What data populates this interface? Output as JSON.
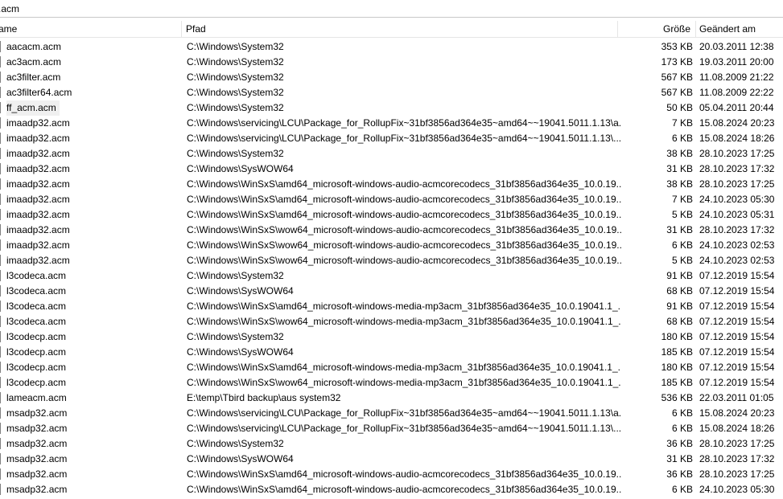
{
  "search": {
    "value": ".acm"
  },
  "columns": {
    "name": "ame",
    "path": "Pfad",
    "size": "Größe",
    "modified": "Geändert am"
  },
  "rows": [
    {
      "name": "aacacm.acm",
      "path": "C:\\Windows\\System32",
      "size": "353 KB",
      "date": "20.03.2011 12:38"
    },
    {
      "name": "ac3acm.acm",
      "path": "C:\\Windows\\System32",
      "size": "173 KB",
      "date": "19.03.2011 20:00"
    },
    {
      "name": "ac3filter.acm",
      "path": "C:\\Windows\\System32",
      "size": "567 KB",
      "date": "11.08.2009 21:22"
    },
    {
      "name": "ac3filter64.acm",
      "path": "C:\\Windows\\System32",
      "size": "567 KB",
      "date": "11.08.2009 22:22"
    },
    {
      "name": "ff_acm.acm",
      "path": "C:\\Windows\\System32",
      "size": "50 KB",
      "date": "05.04.2011 20:44"
    },
    {
      "name": "imaadp32.acm",
      "path": "C:\\Windows\\servicing\\LCU\\Package_for_RollupFix~31bf3856ad364e35~amd64~~19041.5011.1.13\\a...",
      "size": "7 KB",
      "date": "15.08.2024 20:23"
    },
    {
      "name": "imaadp32.acm",
      "path": "C:\\Windows\\servicing\\LCU\\Package_for_RollupFix~31bf3856ad364e35~amd64~~19041.5011.1.13\\...",
      "size": "6 KB",
      "date": "15.08.2024 18:26"
    },
    {
      "name": "imaadp32.acm",
      "path": "C:\\Windows\\System32",
      "size": "38 KB",
      "date": "28.10.2023 17:25"
    },
    {
      "name": "imaadp32.acm",
      "path": "C:\\Windows\\SysWOW64",
      "size": "31 KB",
      "date": "28.10.2023 17:32"
    },
    {
      "name": "imaadp32.acm",
      "path": "C:\\Windows\\WinSxS\\amd64_microsoft-windows-audio-acmcorecodecs_31bf3856ad364e35_10.0.19...",
      "size": "38 KB",
      "date": "28.10.2023 17:25"
    },
    {
      "name": "imaadp32.acm",
      "path": "C:\\Windows\\WinSxS\\amd64_microsoft-windows-audio-acmcorecodecs_31bf3856ad364e35_10.0.19...",
      "size": "7 KB",
      "date": "24.10.2023 05:30"
    },
    {
      "name": "imaadp32.acm",
      "path": "C:\\Windows\\WinSxS\\amd64_microsoft-windows-audio-acmcorecodecs_31bf3856ad364e35_10.0.19...",
      "size": "5 KB",
      "date": "24.10.2023 05:31"
    },
    {
      "name": "imaadp32.acm",
      "path": "C:\\Windows\\WinSxS\\wow64_microsoft-windows-audio-acmcorecodecs_31bf3856ad364e35_10.0.19...",
      "size": "31 KB",
      "date": "28.10.2023 17:32"
    },
    {
      "name": "imaadp32.acm",
      "path": "C:\\Windows\\WinSxS\\wow64_microsoft-windows-audio-acmcorecodecs_31bf3856ad364e35_10.0.19...",
      "size": "6 KB",
      "date": "24.10.2023 02:53"
    },
    {
      "name": "imaadp32.acm",
      "path": "C:\\Windows\\WinSxS\\wow64_microsoft-windows-audio-acmcorecodecs_31bf3856ad364e35_10.0.19...",
      "size": "5 KB",
      "date": "24.10.2023 02:53"
    },
    {
      "name": "l3codeca.acm",
      "path": "C:\\Windows\\System32",
      "size": "91 KB",
      "date": "07.12.2019 15:54"
    },
    {
      "name": "l3codeca.acm",
      "path": "C:\\Windows\\SysWOW64",
      "size": "68 KB",
      "date": "07.12.2019 15:54"
    },
    {
      "name": "l3codeca.acm",
      "path": "C:\\Windows\\WinSxS\\amd64_microsoft-windows-media-mp3acm_31bf3856ad364e35_10.0.19041.1_...",
      "size": "91 KB",
      "date": "07.12.2019 15:54"
    },
    {
      "name": "l3codeca.acm",
      "path": "C:\\Windows\\WinSxS\\wow64_microsoft-windows-media-mp3acm_31bf3856ad364e35_10.0.19041.1_...",
      "size": "68 KB",
      "date": "07.12.2019 15:54"
    },
    {
      "name": "l3codecp.acm",
      "path": "C:\\Windows\\System32",
      "size": "180 KB",
      "date": "07.12.2019 15:54"
    },
    {
      "name": "l3codecp.acm",
      "path": "C:\\Windows\\SysWOW64",
      "size": "185 KB",
      "date": "07.12.2019 15:54"
    },
    {
      "name": "l3codecp.acm",
      "path": "C:\\Windows\\WinSxS\\amd64_microsoft-windows-media-mp3acm_31bf3856ad364e35_10.0.19041.1_...",
      "size": "180 KB",
      "date": "07.12.2019 15:54"
    },
    {
      "name": "l3codecp.acm",
      "path": "C:\\Windows\\WinSxS\\wow64_microsoft-windows-media-mp3acm_31bf3856ad364e35_10.0.19041.1_...",
      "size": "185 KB",
      "date": "07.12.2019 15:54"
    },
    {
      "name": "lameacm.acm",
      "path": "E:\\temp\\Tbird backup\\aus system32",
      "size": "536 KB",
      "date": "22.03.2011 01:05"
    },
    {
      "name": "msadp32.acm",
      "path": "C:\\Windows\\servicing\\LCU\\Package_for_RollupFix~31bf3856ad364e35~amd64~~19041.5011.1.13\\a...",
      "size": "6 KB",
      "date": "15.08.2024 20:23"
    },
    {
      "name": "msadp32.acm",
      "path": "C:\\Windows\\servicing\\LCU\\Package_for_RollupFix~31bf3856ad364e35~amd64~~19041.5011.1.13\\...",
      "size": "6 KB",
      "date": "15.08.2024 18:26"
    },
    {
      "name": "msadp32.acm",
      "path": "C:\\Windows\\System32",
      "size": "36 KB",
      "date": "28.10.2023 17:25"
    },
    {
      "name": "msadp32.acm",
      "path": "C:\\Windows\\SysWOW64",
      "size": "31 KB",
      "date": "28.10.2023 17:32"
    },
    {
      "name": "msadp32.acm",
      "path": "C:\\Windows\\WinSxS\\amd64_microsoft-windows-audio-acmcorecodecs_31bf3856ad364e35_10.0.19...",
      "size": "36 KB",
      "date": "28.10.2023 17:25"
    },
    {
      "name": "msadp32.acm",
      "path": "C:\\Windows\\WinSxS\\amd64_microsoft-windows-audio-acmcorecodecs_31bf3856ad364e35_10.0.19...",
      "size": "6 KB",
      "date": "24.10.2023 05:30"
    }
  ]
}
